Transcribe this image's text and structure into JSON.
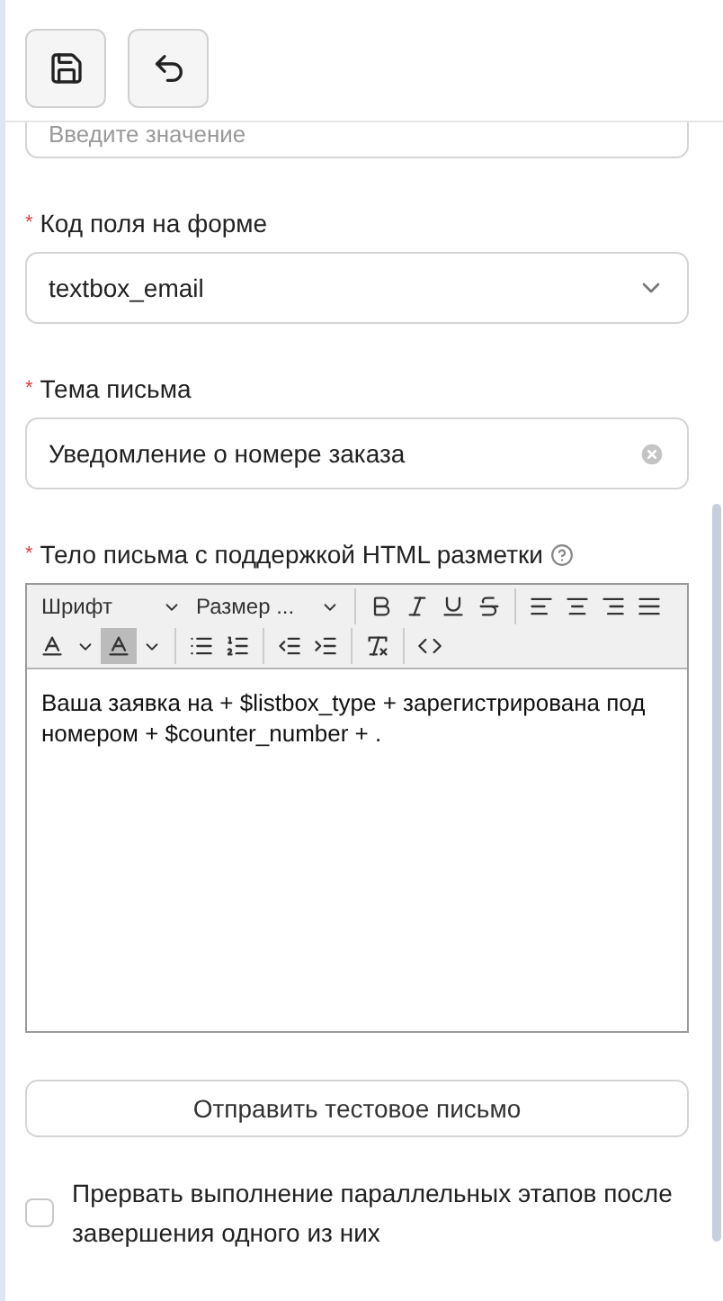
{
  "toolbar": {
    "buttons": [
      {
        "kind": "save"
      },
      {
        "kind": "undo"
      }
    ]
  },
  "fields": [
    {
      "kind": "text",
      "placeholder": "Введите значение"
    },
    {
      "kind": "select",
      "label": "Код поля на форме",
      "required_mark": "*",
      "value": "textbox_email"
    },
    {
      "kind": "text",
      "label": "Тема письма",
      "required_mark": "*",
      "value": "Уведомление о номере заказа",
      "clearable": true
    },
    {
      "kind": "editor",
      "label": "Тело письма с поддержкой HTML разметки",
      "required_mark": "*",
      "help": true,
      "font": "Шрифт",
      "size": "Размер ...",
      "value": "Ваша заявка на + $listbox_type + зарегистрирована под номером + $counter_number + ."
    }
  ],
  "test_button": "Отправить тестовое письмо",
  "checkbox": {
    "label": "Прервать выполнение параллельных этапов после завершения одного из них",
    "checked": false
  }
}
